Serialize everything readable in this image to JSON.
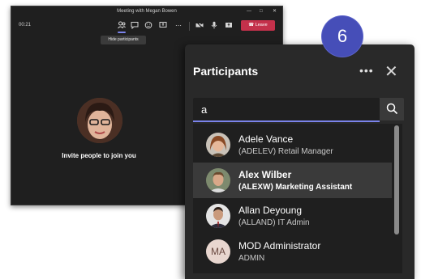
{
  "meeting": {
    "title": "Meeting with Megan Bowen",
    "timer": "00:21",
    "tooltip": "Hide participants",
    "leave_label": "Leave",
    "invite_text": "Invite people to join you"
  },
  "panel": {
    "title": "Participants",
    "more_icon": "ellipsis-icon",
    "close_icon": "close-icon",
    "search": {
      "value": "a",
      "icon": "search-icon"
    },
    "participants": [
      {
        "name": "Adele Vance",
        "detail": "(ADELEV) Retail Manager",
        "avatar": "photo",
        "selected": false
      },
      {
        "name": "Alex Wilber",
        "detail": "(ALEXW) Marketing Assistant",
        "avatar": "photo",
        "selected": true
      },
      {
        "name": "Allan Deyoung",
        "detail": "(ALLAND) IT Admin",
        "avatar": "photo",
        "selected": false
      },
      {
        "name": "MOD Administrator",
        "detail": "ADMIN",
        "avatar": "MA",
        "selected": false
      }
    ]
  },
  "step_badge": "6",
  "colors": {
    "accent": "#7b83eb",
    "leave": "#c4314b",
    "badge": "#464eb8",
    "panel_bg": "#292929"
  }
}
